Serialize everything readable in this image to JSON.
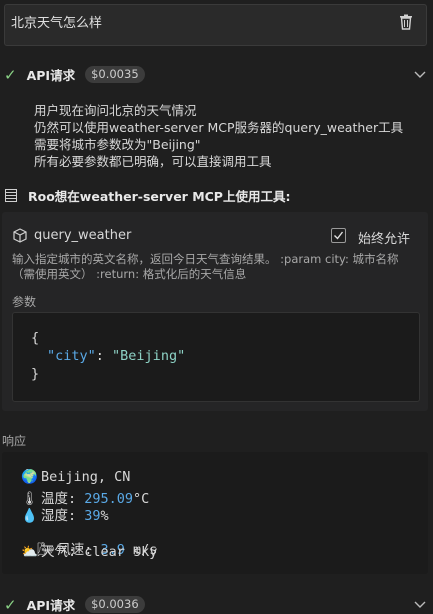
{
  "query": {
    "text": "北京天气怎么样"
  },
  "api_request_1": {
    "label": "API请求",
    "cost": "$0.0035"
  },
  "thinking": {
    "lines": [
      "用户现在询问北京的天气情况",
      "仍然可以使用weather-server MCP服务器的query_weather工具",
      "需要将城市参数改为\"Beijing\"",
      "所有必要参数都已明确，可以直接调用工具"
    ]
  },
  "tool_use": {
    "header": "Roo想在weather-server MCP上使用工具:",
    "tool_name": "query_weather",
    "always_allow_label": "始终允许",
    "description_lines": [
      "输入指定城市的英文名称，返回今日天气查询结果。 :param city: 城市名称",
      "（需使用英文） :return: 格式化后的天气信息"
    ],
    "params_label": "参数",
    "params": {
      "open": "{",
      "key": "\"city\"",
      "colon": ": ",
      "value": "\"Beijing\"",
      "close": "}"
    }
  },
  "response": {
    "label": "响应",
    "location": {
      "emoji": "🌍",
      "text": "Beijing, CN"
    },
    "temperature": {
      "emoji": "🌡",
      "label": "温度: ",
      "value": "295.09",
      "unit": "°C"
    },
    "humidity": {
      "emoji": "💧",
      "label": "湿度: ",
      "value": "39",
      "unit": "%"
    },
    "wind": {
      "emoji": "🌬",
      "label": "风速: ",
      "value": "3.9",
      "unit": " m/s"
    },
    "weather": {
      "emoji": "⛅",
      "label": "天气: ",
      "value": "clear sky"
    }
  },
  "api_request_2": {
    "label": "API请求",
    "cost": "$0.0036"
  },
  "colors": {
    "check": "#89d185",
    "json_key": "#5aa9e6",
    "json_string": "#8ed3c6",
    "number": "#5aa9e6"
  }
}
